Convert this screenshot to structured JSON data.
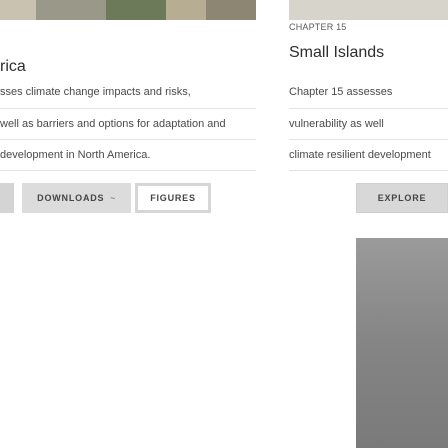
{
  "left_card": {
    "title_fragment": "rica",
    "lines": [
      "sses climate change impacts and risks,",
      "well as barriers and options for adaptation and",
      "development in North America."
    ],
    "buttons": {
      "downloads_label": "DOWNLOADS",
      "downloads_caret": "~",
      "figures_label": "FIGURES"
    }
  },
  "right_card": {
    "chapter_label": "CHAPTER 15",
    "title": "Small Islands",
    "lines": [
      "Chapter 15 assesses",
      "vulnerability as well",
      "climate resilient development"
    ],
    "explore_label": "EXPLORE"
  },
  "colors": {
    "button_grey": "#dcdcdc",
    "panel_grey": "#8a8a8a",
    "text_dark": "#2e2e2e"
  },
  "icons": {
    "caret": "chevron-down-icon"
  }
}
